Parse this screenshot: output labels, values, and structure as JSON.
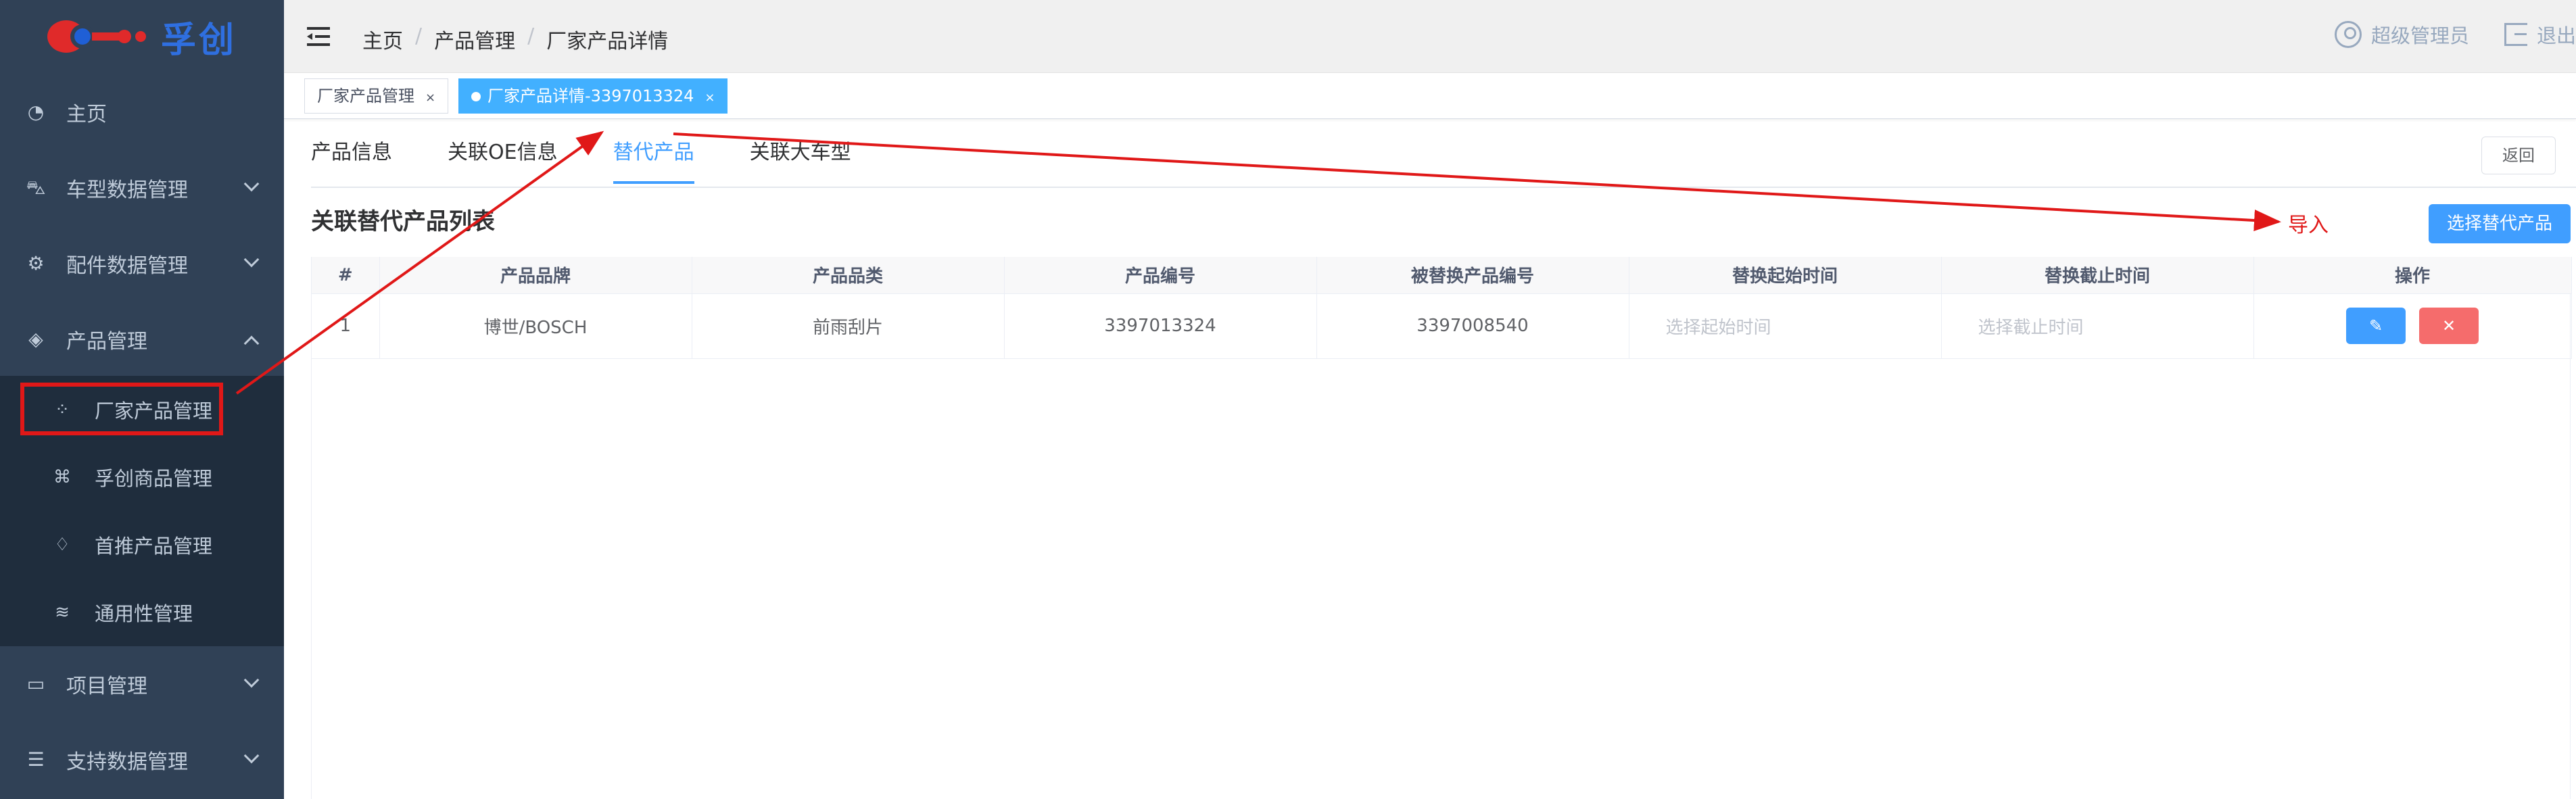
{
  "logo": {
    "text": "孚创"
  },
  "sidebar": {
    "items": [
      {
        "label": "主页",
        "icon": "dashboard-icon"
      },
      {
        "label": "车型数据管理",
        "icon": "car-icon"
      },
      {
        "label": "配件数据管理",
        "icon": "parts-icon"
      },
      {
        "label": "产品管理",
        "icon": "box-icon",
        "expanded": true
      },
      {
        "label": "项目管理",
        "icon": "project-icon"
      },
      {
        "label": "支持数据管理",
        "icon": "database-icon"
      }
    ],
    "subitems": [
      {
        "label": "厂家产品管理",
        "icon": "grid-icon",
        "active": true
      },
      {
        "label": "孚创商品管理",
        "icon": "command-icon"
      },
      {
        "label": "首推产品管理",
        "icon": "thumbs-up-icon"
      },
      {
        "label": "通用性管理",
        "icon": "layers-icon"
      }
    ]
  },
  "navbar": {
    "breadcrumb": [
      "主页",
      "产品管理",
      "厂家产品详情"
    ],
    "user": "超级管理员",
    "logout": "退出"
  },
  "tags": [
    {
      "label": "厂家产品管理",
      "close": "×"
    },
    {
      "label": "厂家产品详情-3397013324",
      "close": "×",
      "active": true
    }
  ],
  "tabs": [
    {
      "label": "产品信息"
    },
    {
      "label": "关联OE信息"
    },
    {
      "label": "替代产品",
      "active": true
    },
    {
      "label": "关联大车型"
    }
  ],
  "back_label": "返回",
  "section_title": "关联替代产品列表",
  "annotation": {
    "import_label": "导入",
    "color": "#e01818"
  },
  "select_button": "选择替代产品",
  "table": {
    "headers": [
      "#",
      "产品品牌",
      "产品品类",
      "产品编号",
      "被替换产品编号",
      "替换起始时间",
      "替换截止时间",
      "操作"
    ],
    "rows": [
      {
        "index": "1",
        "brand": "博世/BOSCH",
        "category": "前雨刮片",
        "product_no": "3397013324",
        "replaced_no": "3397008540",
        "start_placeholder": "选择起始时间",
        "end_placeholder": "选择截止时间",
        "edit_icon": "edit-icon",
        "delete_icon": "close-icon"
      }
    ]
  },
  "colors": {
    "primary": "#409eff",
    "danger": "#f56c6c",
    "sidebar": "#304156",
    "annotation": "#e01818"
  }
}
